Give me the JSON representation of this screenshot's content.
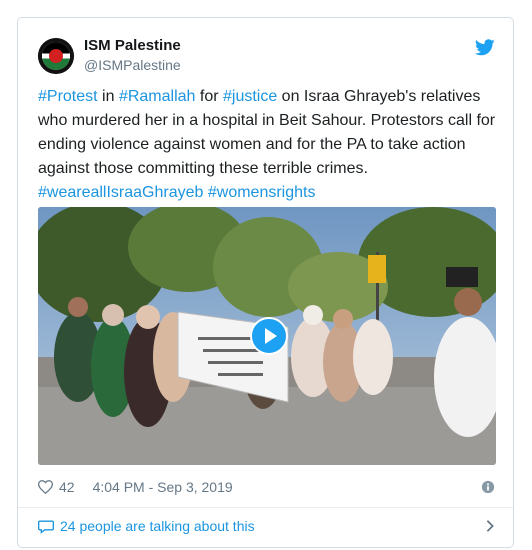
{
  "account": {
    "name": "ISM Palestine",
    "handle": "@ISMPalestine"
  },
  "tweet": {
    "segments": [
      {
        "text": "#Protest",
        "tag": true
      },
      {
        "text": " in ",
        "tag": false
      },
      {
        "text": "#Ramallah",
        "tag": true
      },
      {
        "text": " for ",
        "tag": false
      },
      {
        "text": "#justice",
        "tag": true
      },
      {
        "text": " on Israa Ghrayeb's relatives who murdered her in a hospital in Beit Sahour. Protestors call for ending violence against women and for the PA to take action against those committing these terrible crimes.",
        "tag": false
      },
      {
        "text": "\n",
        "tag": false
      },
      {
        "text": "#weareallIsraaGhrayeb",
        "tag": true
      },
      {
        "text": " ",
        "tag": false
      },
      {
        "text": "#womensrights",
        "tag": true
      }
    ]
  },
  "media": {
    "type": "video",
    "icon": "play-icon"
  },
  "meta": {
    "likes": "42",
    "timestamp": "4:04 PM - Sep 3, 2019"
  },
  "footer": {
    "talking": "24 people are talking about this"
  },
  "colors": {
    "link": "#1b95e0",
    "twitter_blue": "#1da1f2",
    "muted": "#657786",
    "border": "#d5dde3"
  },
  "icons": {
    "twitter": "twitter-bird-icon",
    "like": "heart-icon",
    "info": "info-icon",
    "conversation": "speech-bubble-icon",
    "chevron": "chevron-right-icon"
  }
}
